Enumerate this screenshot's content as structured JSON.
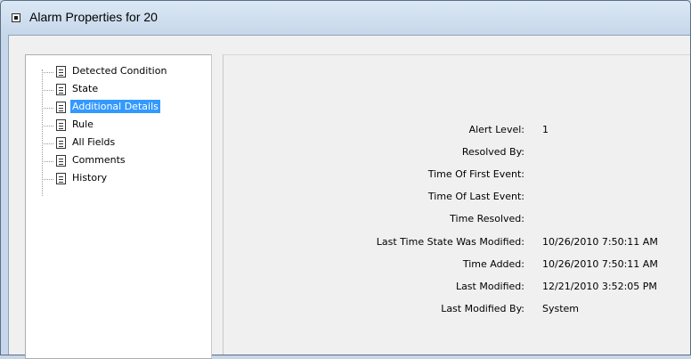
{
  "window": {
    "title": "Alarm Properties for 20"
  },
  "tree": {
    "items": [
      {
        "label": "Detected Condition",
        "selected": false
      },
      {
        "label": "State",
        "selected": false
      },
      {
        "label": "Additional Details",
        "selected": true
      },
      {
        "label": "Rule",
        "selected": false
      },
      {
        "label": "All Fields",
        "selected": false
      },
      {
        "label": "Comments",
        "selected": false
      },
      {
        "label": "History",
        "selected": false
      }
    ]
  },
  "details": {
    "rows": [
      {
        "label": "Alert Level:",
        "value": "1"
      },
      {
        "label": "Resolved By:",
        "value": ""
      },
      {
        "label": "Time Of First Event:",
        "value": ""
      },
      {
        "label": "Time Of Last Event:",
        "value": ""
      },
      {
        "label": "Time Resolved:",
        "value": ""
      },
      {
        "label": "Last Time State Was Modified:",
        "value": "10/26/2010 7:50:11 AM"
      },
      {
        "label": "Time Added:",
        "value": "10/26/2010 7:50:11 AM"
      },
      {
        "label": "Last Modified:",
        "value": "12/21/2010 3:52:05 PM"
      },
      {
        "label": "Last Modified By:",
        "value": "System"
      }
    ]
  },
  "colors": {
    "selection": "#3399ff",
    "panel_bg": "#f0f0f0",
    "frame": "#c6d7ea"
  }
}
